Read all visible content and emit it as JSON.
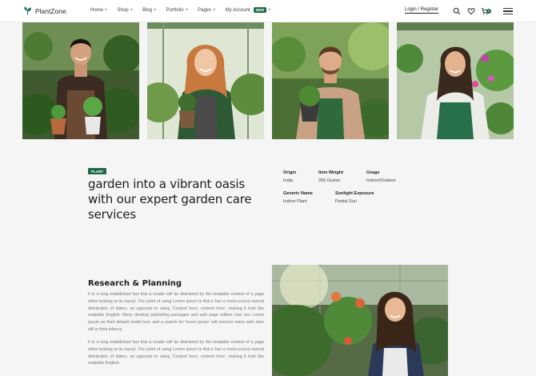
{
  "brand": {
    "name": "PlantZone",
    "accent": "#1e6b4a"
  },
  "nav": {
    "items": [
      {
        "label": "Home"
      },
      {
        "label": "Shop"
      },
      {
        "label": "Blog"
      },
      {
        "label": "Portfolio"
      },
      {
        "label": "Pages"
      },
      {
        "label": "My Account",
        "badge": "NEW"
      }
    ],
    "expand_symbol": "+"
  },
  "header": {
    "login_label": "Login / Register",
    "cart_count": "0",
    "icons": [
      "search-icon",
      "heart-icon",
      "cart-icon",
      "menu-icon"
    ]
  },
  "team": {
    "photos": [
      {
        "icon": "gardener-photo-1"
      },
      {
        "icon": "gardener-photo-2"
      },
      {
        "icon": "gardener-photo-3"
      },
      {
        "icon": "gardener-photo-4"
      }
    ]
  },
  "intro": {
    "tag": "PLANT",
    "headline": "garden into a vibrant oasis with our expert garden care services",
    "specs": [
      {
        "label": "Origin",
        "value": "India"
      },
      {
        "label": "Item Weight",
        "value": "265 Grams"
      },
      {
        "label": "Usage",
        "value": "Indoor/Outdoor"
      },
      {
        "label": "Generic Name",
        "value": "Indoor Plant"
      },
      {
        "label": "Sunlight Exposure",
        "value": "Partial Sun"
      }
    ]
  },
  "research": {
    "title": "Research & Planning",
    "paragraphs": [
      "It is a long established fact that a reader will be distracted by the readable content of a page when looking at its layout. The point of using Lorem Ipsum is that it has a more-or-less normal distribution of letters, as opposed to using 'Content here, content here', making it look like readable English. Many desktop publishing packages and web page editors now use Lorem Ipsum as their default model text, and a search for 'lorem ipsum' will uncover many web sites still in their infancy.",
      "It is a long established fact that a reader will be distracted by the readable content of a page when looking at its layout. The point of using Lorem Ipsum is that it has a more-or-less normal distribution of letters, as opposed to using 'Content here, content here', making it look like readable English."
    ]
  }
}
